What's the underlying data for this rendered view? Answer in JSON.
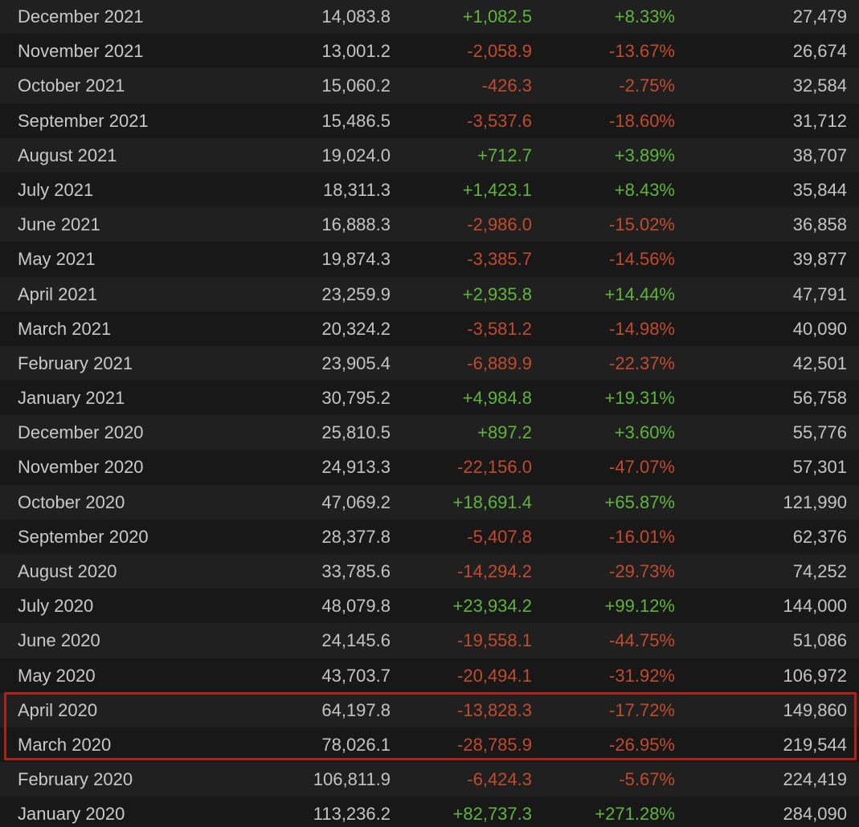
{
  "table": {
    "rows": [
      {
        "month": "December 2021",
        "avg": "14,083.8",
        "gain": "+1,082.5",
        "pct": "+8.33%",
        "peak": "27,479",
        "trend": "pos"
      },
      {
        "month": "November 2021",
        "avg": "13,001.2",
        "gain": "-2,058.9",
        "pct": "-13.67%",
        "peak": "26,674",
        "trend": "neg"
      },
      {
        "month": "October 2021",
        "avg": "15,060.2",
        "gain": "-426.3",
        "pct": "-2.75%",
        "peak": "32,584",
        "trend": "neg"
      },
      {
        "month": "September 2021",
        "avg": "15,486.5",
        "gain": "-3,537.6",
        "pct": "-18.60%",
        "peak": "31,712",
        "trend": "neg"
      },
      {
        "month": "August 2021",
        "avg": "19,024.0",
        "gain": "+712.7",
        "pct": "+3.89%",
        "peak": "38,707",
        "trend": "pos"
      },
      {
        "month": "July 2021",
        "avg": "18,311.3",
        "gain": "+1,423.1",
        "pct": "+8.43%",
        "peak": "35,844",
        "trend": "pos"
      },
      {
        "month": "June 2021",
        "avg": "16,888.3",
        "gain": "-2,986.0",
        "pct": "-15.02%",
        "peak": "36,858",
        "trend": "neg"
      },
      {
        "month": "May 2021",
        "avg": "19,874.3",
        "gain": "-3,385.7",
        "pct": "-14.56%",
        "peak": "39,877",
        "trend": "neg"
      },
      {
        "month": "April 2021",
        "avg": "23,259.9",
        "gain": "+2,935.8",
        "pct": "+14.44%",
        "peak": "47,791",
        "trend": "pos"
      },
      {
        "month": "March 2021",
        "avg": "20,324.2",
        "gain": "-3,581.2",
        "pct": "-14.98%",
        "peak": "40,090",
        "trend": "neg"
      },
      {
        "month": "February 2021",
        "avg": "23,905.4",
        "gain": "-6,889.9",
        "pct": "-22.37%",
        "peak": "42,501",
        "trend": "neg"
      },
      {
        "month": "January 2021",
        "avg": "30,795.2",
        "gain": "+4,984.8",
        "pct": "+19.31%",
        "peak": "56,758",
        "trend": "pos"
      },
      {
        "month": "December 2020",
        "avg": "25,810.5",
        "gain": "+897.2",
        "pct": "+3.60%",
        "peak": "55,776",
        "trend": "pos"
      },
      {
        "month": "November 2020",
        "avg": "24,913.3",
        "gain": "-22,156.0",
        "pct": "-47.07%",
        "peak": "57,301",
        "trend": "neg"
      },
      {
        "month": "October 2020",
        "avg": "47,069.2",
        "gain": "+18,691.4",
        "pct": "+65.87%",
        "peak": "121,990",
        "trend": "pos"
      },
      {
        "month": "September 2020",
        "avg": "28,377.8",
        "gain": "-5,407.8",
        "pct": "-16.01%",
        "peak": "62,376",
        "trend": "neg"
      },
      {
        "month": "August 2020",
        "avg": "33,785.6",
        "gain": "-14,294.2",
        "pct": "-29.73%",
        "peak": "74,252",
        "trend": "neg"
      },
      {
        "month": "July 2020",
        "avg": "48,079.8",
        "gain": "+23,934.2",
        "pct": "+99.12%",
        "peak": "144,000",
        "trend": "pos"
      },
      {
        "month": "June 2020",
        "avg": "24,145.6",
        "gain": "-19,558.1",
        "pct": "-44.75%",
        "peak": "51,086",
        "trend": "neg"
      },
      {
        "month": "May 2020",
        "avg": "43,703.7",
        "gain": "-20,494.1",
        "pct": "-31.92%",
        "peak": "106,972",
        "trend": "neg"
      },
      {
        "month": "April 2020",
        "avg": "64,197.8",
        "gain": "-13,828.3",
        "pct": "-17.72%",
        "peak": "149,860",
        "trend": "neg",
        "highlighted": true
      },
      {
        "month": "March 2020",
        "avg": "78,026.1",
        "gain": "-28,785.9",
        "pct": "-26.95%",
        "peak": "219,544",
        "trend": "neg",
        "highlighted": true
      },
      {
        "month": "February 2020",
        "avg": "106,811.9",
        "gain": "-6,424.3",
        "pct": "-5.67%",
        "peak": "224,419",
        "trend": "neg"
      },
      {
        "month": "January 2020",
        "avg": "113,236.2",
        "gain": "+82,737.3",
        "pct": "+271.28%",
        "peak": "284,090",
        "trend": "pos"
      }
    ]
  },
  "colors": {
    "background": "#1b1b1b",
    "positive": "#5fb53b",
    "negative": "#c24b2c",
    "highlight_border": "#b0211c"
  }
}
